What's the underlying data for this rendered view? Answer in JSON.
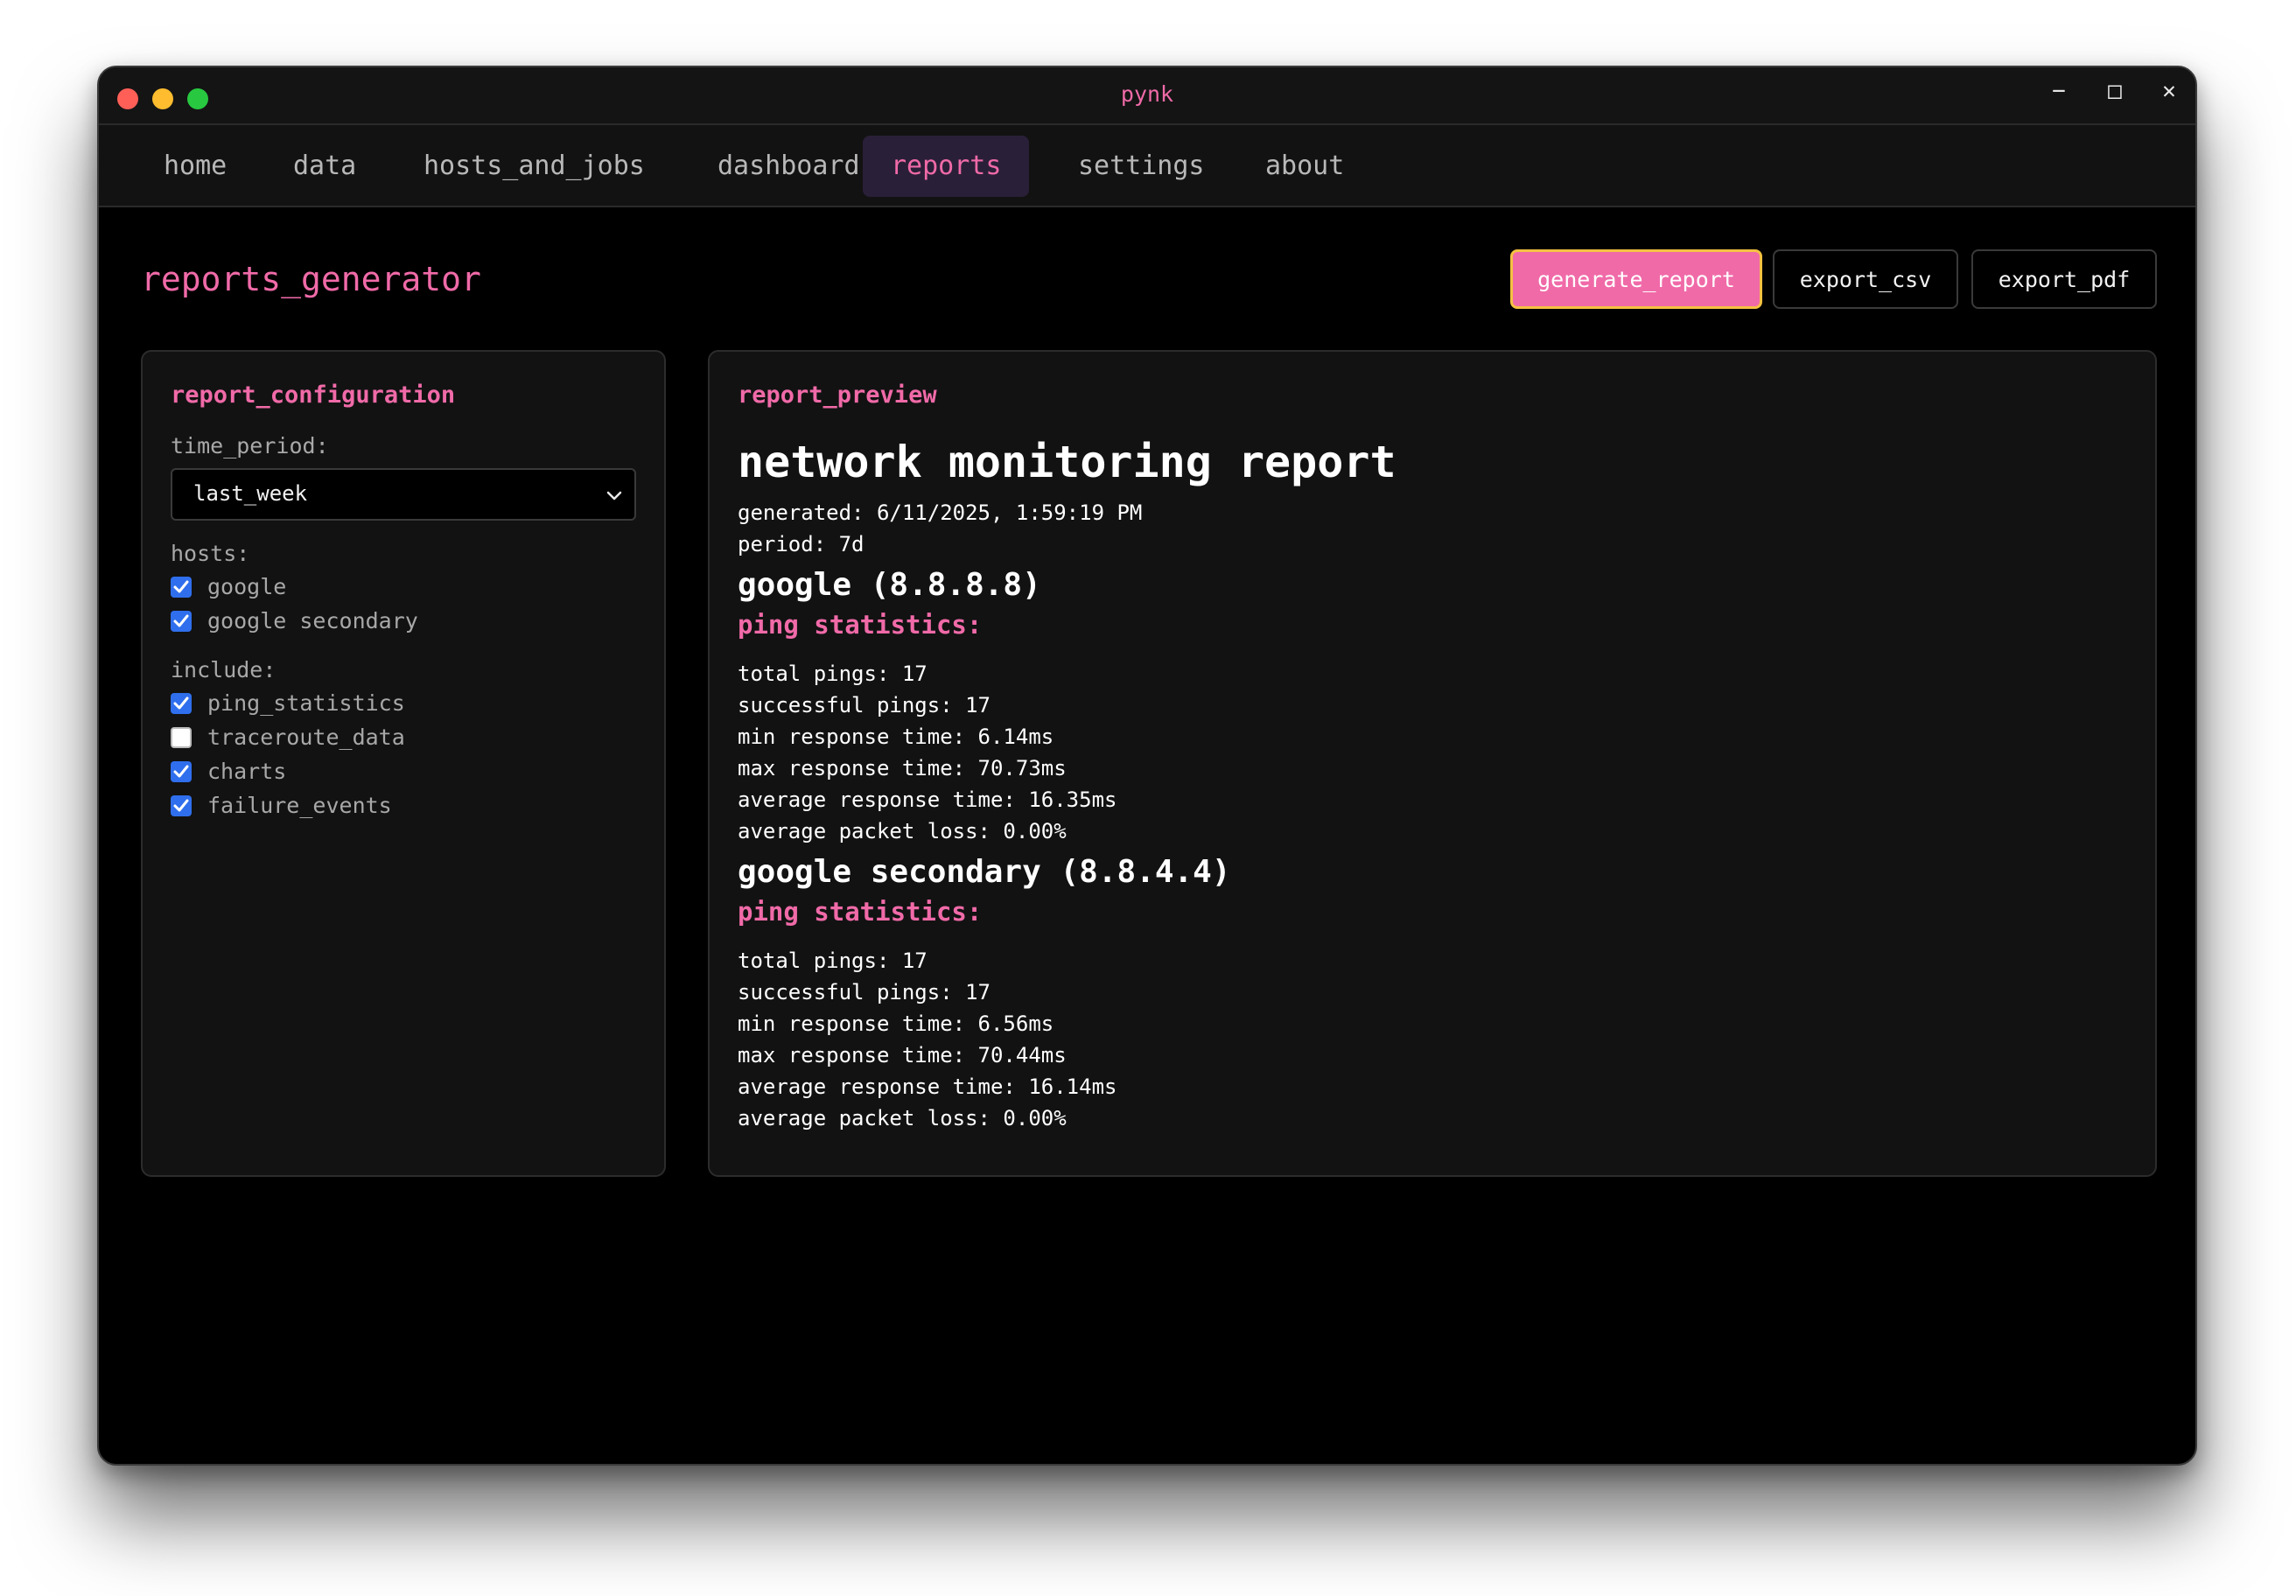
{
  "window": {
    "title": "pynk",
    "controls": {
      "minimize": "−",
      "maximize": "□",
      "close": "✕"
    }
  },
  "nav": {
    "items": [
      {
        "label": "home",
        "active": false
      },
      {
        "label": "data",
        "active": false
      },
      {
        "label": "hosts_and_jobs",
        "active": false
      },
      {
        "label": "dashboard",
        "active": false
      },
      {
        "label": "reports",
        "active": true
      },
      {
        "label": "settings",
        "active": false
      },
      {
        "label": "about",
        "active": false
      }
    ]
  },
  "page": {
    "title": "reports_generator",
    "buttons": {
      "generate": "generate_report",
      "csv": "export_csv",
      "pdf": "export_pdf"
    }
  },
  "config": {
    "title": "report_configuration",
    "time_period_label": "time_period:",
    "time_period_value": "last_week",
    "hosts_label": "hosts:",
    "hosts": [
      {
        "label": "google",
        "checked": true
      },
      {
        "label": "google secondary",
        "checked": true
      }
    ],
    "include_label": "include:",
    "include": [
      {
        "label": "ping_statistics",
        "checked": true
      },
      {
        "label": "traceroute_data",
        "checked": false
      },
      {
        "label": "charts",
        "checked": true
      },
      {
        "label": "failure_events",
        "checked": true
      }
    ]
  },
  "preview": {
    "title": "report_preview",
    "report_title": "network monitoring report",
    "generated": "generated: 6/11/2025, 1:59:19 PM",
    "period": "period: 7d",
    "hosts": [
      {
        "heading": "google (8.8.8.8)",
        "subheading": "ping statistics:",
        "stats": [
          "total pings: 17",
          "successful pings: 17",
          "min response time: 6.14ms",
          "max response time: 70.73ms",
          "average response time: 16.35ms",
          "average packet loss: 0.00%"
        ]
      },
      {
        "heading": "google secondary (8.8.4.4)",
        "subheading": "ping statistics:",
        "stats": [
          "total pings: 17",
          "successful pings: 17",
          "min response time: 6.56ms",
          "max response time: 70.44ms",
          "average response time: 16.14ms",
          "average packet loss: 0.00%"
        ]
      }
    ]
  },
  "colors": {
    "accent": "#f06aa8",
    "checkbox": "#2f6fed",
    "focus_border": "#f5c142",
    "background": "#000000",
    "panel": "#121212"
  }
}
